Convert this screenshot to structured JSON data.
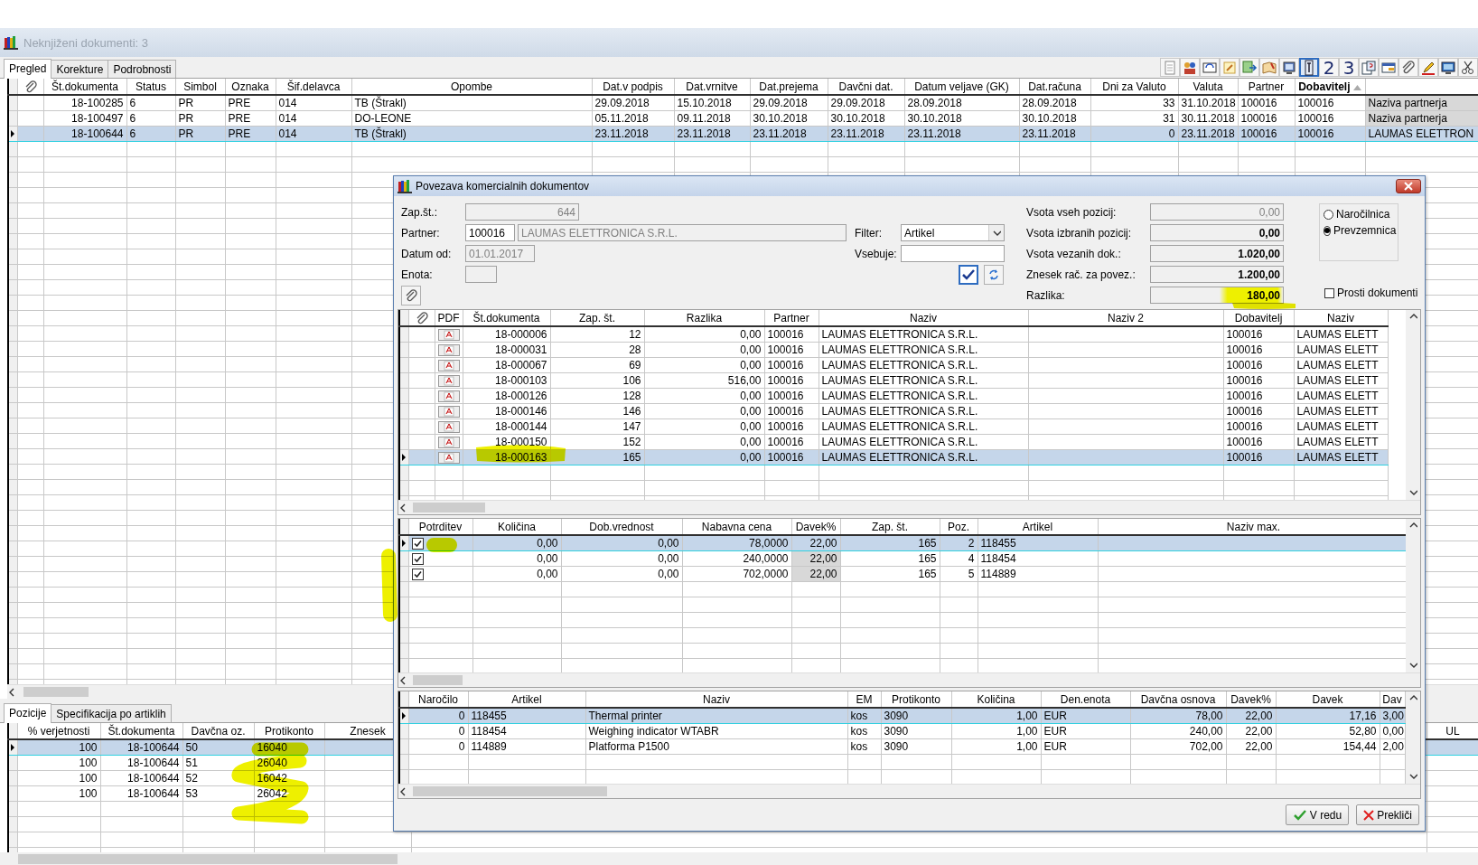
{
  "window": {
    "title": "Neknjiženi dokumenti: 3"
  },
  "tabs": [
    {
      "label": "Pregled",
      "selected": true
    },
    {
      "label": "Korekture",
      "selected": false
    },
    {
      "label": "Podrobnosti",
      "selected": false
    }
  ],
  "toolbar": [
    {
      "kind": "icon",
      "pressed": false
    },
    {
      "kind": "icon",
      "pressed": false
    },
    {
      "kind": "icon",
      "pressed": false
    },
    {
      "kind": "icon",
      "pressed": false
    },
    {
      "kind": "icon",
      "pressed": false
    },
    {
      "kind": "icon",
      "pressed": false
    },
    {
      "kind": "icon",
      "pressed": false
    },
    {
      "kind": "icon",
      "pressed": true
    },
    {
      "kind": "digit",
      "label": "2",
      "pressed": false
    },
    {
      "kind": "digit",
      "label": "3",
      "pressed": false
    },
    {
      "kind": "icon",
      "pressed": false
    },
    {
      "kind": "icon",
      "pressed": false
    },
    {
      "kind": "icon",
      "pressed": false
    },
    {
      "kind": "icon",
      "pressed": false
    },
    {
      "kind": "icon",
      "pressed": false
    },
    {
      "kind": "icon",
      "pressed": false
    }
  ],
  "documents": {
    "columns": [
      {
        "label": "Št.dokumenta",
        "sorted": false
      },
      {
        "label": "Status",
        "sorted": false
      },
      {
        "label": "Simbol",
        "sorted": false
      },
      {
        "label": "Oznaka",
        "sorted": false
      },
      {
        "label": "Šif.delavca",
        "sorted": false
      },
      {
        "label": "Opombe",
        "sorted": false
      },
      {
        "label": "Dat.v podpis",
        "sorted": false
      },
      {
        "label": "Dat.vrnitve",
        "sorted": false
      },
      {
        "label": "Dat.prejema",
        "sorted": false
      },
      {
        "label": "Davčni dat.",
        "sorted": false
      },
      {
        "label": "Datum veljave (GK)",
        "sorted": false
      },
      {
        "label": "Dat.računa",
        "sorted": false
      },
      {
        "label": "Dni za Valuto",
        "sorted": false
      },
      {
        "label": "Valuta",
        "sorted": false
      },
      {
        "label": "Partner",
        "sorted": false
      },
      {
        "label": "Dobavitelj",
        "sorted": true
      }
    ],
    "rows": [
      {
        "selected": false,
        "st_dokumenta": "18-100285",
        "status": "6",
        "simbol": "PR",
        "oznaka": "PRE",
        "sif_delavca": "014",
        "opombe": "TB (Štrakl)",
        "dat_v_podpis": "29.09.2018",
        "dat_vrnitve": "15.10.2018",
        "dat_prejema": "29.09.2018",
        "davcni_dat": "29.09.2018",
        "datum_veljave": "28.09.2018",
        "dat_racuna": "28.09.2018",
        "dni_za_valuto": "33",
        "valuta": "31.10.2018",
        "partner": "100016",
        "dobavitelj": "100016",
        "column_17": "Naziva partnerja"
      },
      {
        "selected": false,
        "st_dokumenta": "18-100497",
        "status": "6",
        "simbol": "PR",
        "oznaka": "PRE",
        "sif_delavca": "014",
        "opombe": "DO-LEONE",
        "dat_v_podpis": "05.11.2018",
        "dat_vrnitve": "09.11.2018",
        "dat_prejema": "30.10.2018",
        "davcni_dat": "30.10.2018",
        "datum_veljave": "30.10.2018",
        "dat_racuna": "30.10.2018",
        "dni_za_valuto": "31",
        "valuta": "30.11.2018",
        "partner": "100016",
        "dobavitelj": "100016",
        "column_17": "Naziva partnerja"
      },
      {
        "selected": true,
        "st_dokumenta": "18-100644",
        "status": "6",
        "simbol": "PR",
        "oznaka": "PRE",
        "sif_delavca": "014",
        "opombe": "TB (Štrakl)",
        "dat_v_podpis": "23.11.2018",
        "dat_vrnitve": "23.11.2018",
        "dat_prejema": "23.11.2018",
        "davcni_dat": "23.11.2018",
        "datum_veljave": "23.11.2018",
        "dat_racuna": "23.11.2018",
        "dni_za_valuto": "0",
        "valuta": "23.11.2018",
        "partner": "100016",
        "dobavitelj": "100016",
        "column_17": "LAUMAS ELETTRON"
      }
    ]
  },
  "bottom_tabs": [
    {
      "label": "Pozicije",
      "selected": true
    },
    {
      "label": "Specifikacija po artiklih",
      "selected": false
    }
  ],
  "positions": {
    "columns": [
      {
        "label": "% verjetnosti"
      },
      {
        "label": "Št.dokumenta"
      },
      {
        "label": "Davčna oz."
      },
      {
        "label": "Protikonto"
      },
      {
        "label": "Znesek"
      },
      {
        "label": "UL"
      }
    ],
    "rows": [
      {
        "selected": true,
        "verjetnost": "100",
        "st_dokumenta": "18-100644",
        "davcna_oz": "50",
        "protikonto": "16040"
      },
      {
        "selected": false,
        "verjetnost": "100",
        "st_dokumenta": "18-100644",
        "davcna_oz": "51",
        "protikonto": "26040"
      },
      {
        "selected": false,
        "verjetnost": "100",
        "st_dokumenta": "18-100644",
        "davcna_oz": "52",
        "protikonto": "16042"
      },
      {
        "selected": false,
        "verjetnost": "100",
        "st_dokumenta": "18-100644",
        "davcna_oz": "53",
        "protikonto": "26042"
      }
    ]
  },
  "dialog": {
    "title": "Povezava komercialnih dokumentov",
    "fields": [
      {
        "label": "Zap.št.:",
        "value": "644",
        "disabled": true
      },
      {
        "label": "Partner:",
        "code": "100016",
        "value": "LAUMAS ELETTRONICA S.R.L.",
        "disabled": true
      },
      {
        "label": "Datum od:",
        "value": "01.01.2017",
        "disabled": true
      },
      {
        "label": "Enota:",
        "disabled": true
      }
    ],
    "filter": {
      "label": "Filter:",
      "value": "Artikel"
    },
    "contains": {
      "label": "Vsebuje:"
    },
    "totals": [
      {
        "label": "Vsota vseh pozicij:",
        "value": "0,00",
        "disabled": true
      },
      {
        "label": "Vsota izbranih pozicij:",
        "value": "0,00",
        "disabled": false
      },
      {
        "label": "Vsota vezanih dok.:",
        "value": "1.020,00",
        "disabled": false
      },
      {
        "label": "Znesek rač. za povez.:",
        "value": "1.200,00",
        "disabled": false
      },
      {
        "label": "Razlika:",
        "value": "180,00",
        "disabled": false
      }
    ],
    "document_types": [
      {
        "label": "Naročilnica",
        "selected": false
      },
      {
        "label": "Prevzemnica",
        "selected": true
      }
    ],
    "free_documents": {
      "label": "Prosti dokumenti",
      "checked": false
    },
    "documents": {
      "columns": [
        {
          "label": "PDF"
        },
        {
          "label": "Št.dokumenta"
        },
        {
          "label": "Zap. št."
        },
        {
          "label": "Razlika"
        },
        {
          "label": "Partner"
        },
        {
          "label": "Naziv"
        },
        {
          "label": "Naziv 2"
        },
        {
          "label": "Dobavitelj"
        },
        {
          "label": "Naziv"
        }
      ],
      "rows": [
        {
          "selected": false,
          "st_dokumenta": "18-000006",
          "zap_st": "12",
          "razlika": "0,00",
          "partner": "100016",
          "naziv": "LAUMAS ELETTRONICA S.R.L.",
          "dobavitelj": "100016",
          "naziv_dob": "LAUMAS ELETT"
        },
        {
          "selected": false,
          "st_dokumenta": "18-000031",
          "zap_st": "28",
          "razlika": "0,00",
          "partner": "100016",
          "naziv": "LAUMAS ELETTRONICA S.R.L.",
          "dobavitelj": "100016",
          "naziv_dob": "LAUMAS ELETT"
        },
        {
          "selected": false,
          "st_dokumenta": "18-000067",
          "zap_st": "69",
          "razlika": "0,00",
          "partner": "100016",
          "naziv": "LAUMAS ELETTRONICA S.R.L.",
          "dobavitelj": "100016",
          "naziv_dob": "LAUMAS ELETT"
        },
        {
          "selected": false,
          "st_dokumenta": "18-000103",
          "zap_st": "106",
          "razlika": "516,00",
          "partner": "100016",
          "naziv": "LAUMAS ELETTRONICA S.R.L.",
          "dobavitelj": "100016",
          "naziv_dob": "LAUMAS ELETT"
        },
        {
          "selected": false,
          "st_dokumenta": "18-000126",
          "zap_st": "128",
          "razlika": "0,00",
          "partner": "100016",
          "naziv": "LAUMAS ELETTRONICA S.R.L.",
          "dobavitelj": "100016",
          "naziv_dob": "LAUMAS ELETT"
        },
        {
          "selected": false,
          "st_dokumenta": "18-000146",
          "zap_st": "146",
          "razlika": "0,00",
          "partner": "100016",
          "naziv": "LAUMAS ELETTRONICA S.R.L.",
          "dobavitelj": "100016",
          "naziv_dob": "LAUMAS ELETT"
        },
        {
          "selected": false,
          "st_dokumenta": "18-000144",
          "zap_st": "147",
          "razlika": "0,00",
          "partner": "100016",
          "naziv": "LAUMAS ELETTRONICA S.R.L.",
          "dobavitelj": "100016",
          "naziv_dob": "LAUMAS ELETT"
        },
        {
          "selected": false,
          "st_dokumenta": "18-000150",
          "zap_st": "152",
          "razlika": "0,00",
          "partner": "100016",
          "naziv": "LAUMAS ELETTRONICA S.R.L.",
          "dobavitelj": "100016",
          "naziv_dob": "LAUMAS ELETT"
        },
        {
          "selected": true,
          "st_dokumenta": "18-000163",
          "zap_st": "165",
          "razlika": "0,00",
          "partner": "100016",
          "naziv": "LAUMAS ELETTRONICA S.R.L.",
          "dobavitelj": "100016",
          "naziv_dob": "LAUMAS ELETT"
        }
      ]
    },
    "lines": {
      "columns": [
        {
          "label": "Potrditev"
        },
        {
          "label": "Količina"
        },
        {
          "label": "Dob.vrednost"
        },
        {
          "label": "Nabavna cena"
        },
        {
          "label": "Davek%"
        },
        {
          "label": "Zap. št."
        },
        {
          "label": "Poz."
        },
        {
          "label": "Artikel"
        },
        {
          "label": "Naziv max."
        }
      ],
      "rows": [
        {
          "selected": true,
          "checked": true,
          "kolicina": "0,00",
          "dob_vrednost": "0,00",
          "nabavna_cena": "78,0000",
          "davek_pct": "22,00",
          "zap_st": "165",
          "poz": "2",
          "artikel": "118455"
        },
        {
          "selected": false,
          "checked": true,
          "kolicina": "0,00",
          "dob_vrednost": "0,00",
          "nabavna_cena": "240,0000",
          "davek_pct": "22,00",
          "zap_st": "165",
          "poz": "4",
          "artikel": "118454"
        },
        {
          "selected": false,
          "checked": true,
          "kolicina": "0,00",
          "dob_vrednost": "0,00",
          "nabavna_cena": "702,0000",
          "davek_pct": "22,00",
          "zap_st": "165",
          "poz": "5",
          "artikel": "114889"
        }
      ]
    },
    "items": {
      "columns": [
        {
          "label": "Naročilo"
        },
        {
          "label": "Artikel"
        },
        {
          "label": "Naziv"
        },
        {
          "label": "EM"
        },
        {
          "label": "Protikonto"
        },
        {
          "label": "Količina"
        },
        {
          "label": "Den.enota"
        },
        {
          "label": "Davčna osnova"
        },
        {
          "label": "Davek%"
        },
        {
          "label": "Davek"
        },
        {
          "label": "Dav"
        }
      ],
      "rows": [
        {
          "selected": true,
          "narocilo": "0",
          "artikel": "118455",
          "naziv": "Thermal printer",
          "em": "kos",
          "protikonto": "3090",
          "kolicina": "1,00",
          "den_enota": "EUR",
          "davcna_osnova": "78,00",
          "davek_pct": "22,00",
          "davek": "17,16",
          "column_12": "3,00"
        },
        {
          "selected": false,
          "narocilo": "0",
          "artikel": "118454",
          "naziv": "Weighing indicator WTABR",
          "em": "kos",
          "protikonto": "3090",
          "kolicina": "1,00",
          "den_enota": "EUR",
          "davcna_osnova": "240,00",
          "davek_pct": "22,00",
          "davek": "52,80",
          "column_12": "0,00"
        },
        {
          "selected": false,
          "narocilo": "0",
          "artikel": "114889",
          "naziv": "Platforma P1500",
          "em": "kos",
          "protikonto": "3090",
          "kolicina": "1,00",
          "den_enota": "EUR",
          "davcna_osnova": "702,00",
          "davek_pct": "22,00",
          "davek": "154,44",
          "column_12": "2,00"
        }
      ]
    },
    "buttons": [
      {
        "label": "V redu",
        "kind": "ok"
      },
      {
        "label": "Prekliči",
        "kind": "cancel"
      }
    ]
  }
}
